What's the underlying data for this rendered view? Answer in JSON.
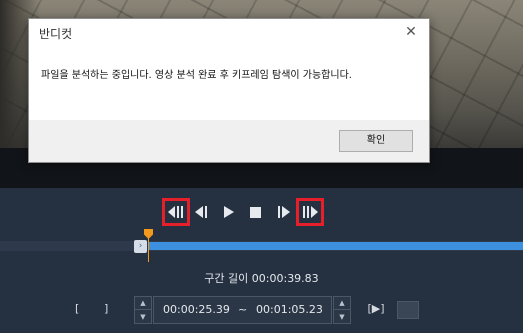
{
  "dialog": {
    "title": "반디컷",
    "close_symbol": "✕",
    "message": "파일을 분석하는 중입니다. 영상 분석 완료 후 키프레임 탐색이 가능합니다.",
    "ok_label": "확인"
  },
  "transport": {
    "buttons": [
      {
        "icon": "prev-keyframe-icon",
        "highlighted": true
      },
      {
        "icon": "prev-frame-icon",
        "highlighted": false
      },
      {
        "icon": "play-icon",
        "highlighted": false
      },
      {
        "icon": "stop-icon",
        "highlighted": false
      },
      {
        "icon": "next-frame-icon",
        "highlighted": false
      },
      {
        "icon": "next-keyframe-icon",
        "highlighted": true
      }
    ]
  },
  "timeline": {
    "handle_symbol": "›"
  },
  "duration": {
    "label": "구간 길이",
    "value": "00:00:39.83"
  },
  "range": {
    "start_bracket": "[",
    "end_bracket": "]",
    "start_time": "00:00:25.39",
    "separator": "~",
    "end_time": "00:01:05.23",
    "play_range_label": "[▶]"
  },
  "colors": {
    "highlight": "#e5202a",
    "selection": "#3d8fe0",
    "playhead": "#f39a1c"
  }
}
